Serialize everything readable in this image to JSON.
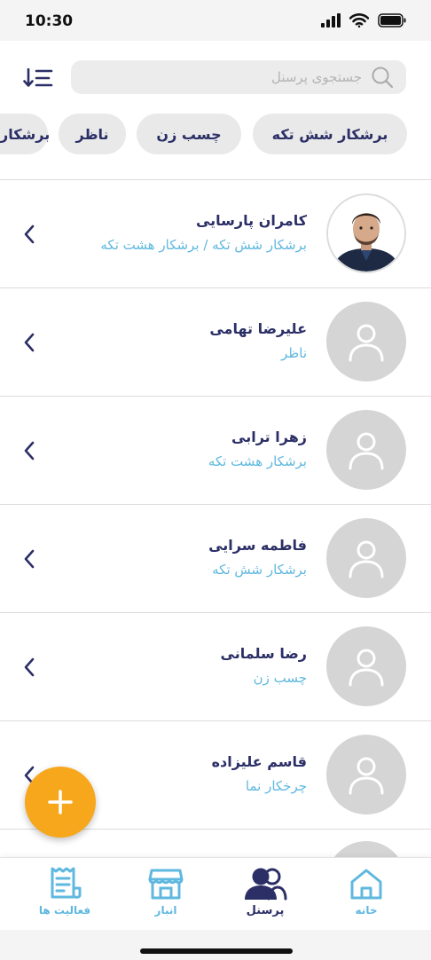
{
  "status_bar": {
    "time": "10:30"
  },
  "search": {
    "placeholder": "جستجوی پرسنل"
  },
  "filters": [
    "برشکار شش تکه",
    "چسب زن",
    "ناظر",
    "برشکار"
  ],
  "personnel": [
    {
      "name": "کامران پارسایی",
      "role": "برشکار شش تکه / برشکار هشت تکه",
      "has_photo": true
    },
    {
      "name": "علیرضا تهامی",
      "role": "ناظر",
      "has_photo": false
    },
    {
      "name": "زهرا ترابی",
      "role": "برشکار هشت تکه",
      "has_photo": false
    },
    {
      "name": "فاطمه سرایی",
      "role": "برشکار شش تکه",
      "has_photo": false
    },
    {
      "name": "رضا سلمانی",
      "role": "چسب زن",
      "has_photo": false
    },
    {
      "name": "قاسم علیزاده",
      "role": "چرخکار نما",
      "has_photo": false
    }
  ],
  "tabs": [
    {
      "label": "خانه",
      "icon": "home-icon",
      "active": false
    },
    {
      "label": "پرسنل",
      "icon": "users-icon",
      "active": true
    },
    {
      "label": "انبار",
      "icon": "store-icon",
      "active": false
    },
    {
      "label": "فعالیت ها",
      "icon": "receipt-icon",
      "active": false
    }
  ],
  "colors": {
    "primary": "#2b2f66",
    "accent": "#5fb8df",
    "fab": "#f7a71b"
  }
}
